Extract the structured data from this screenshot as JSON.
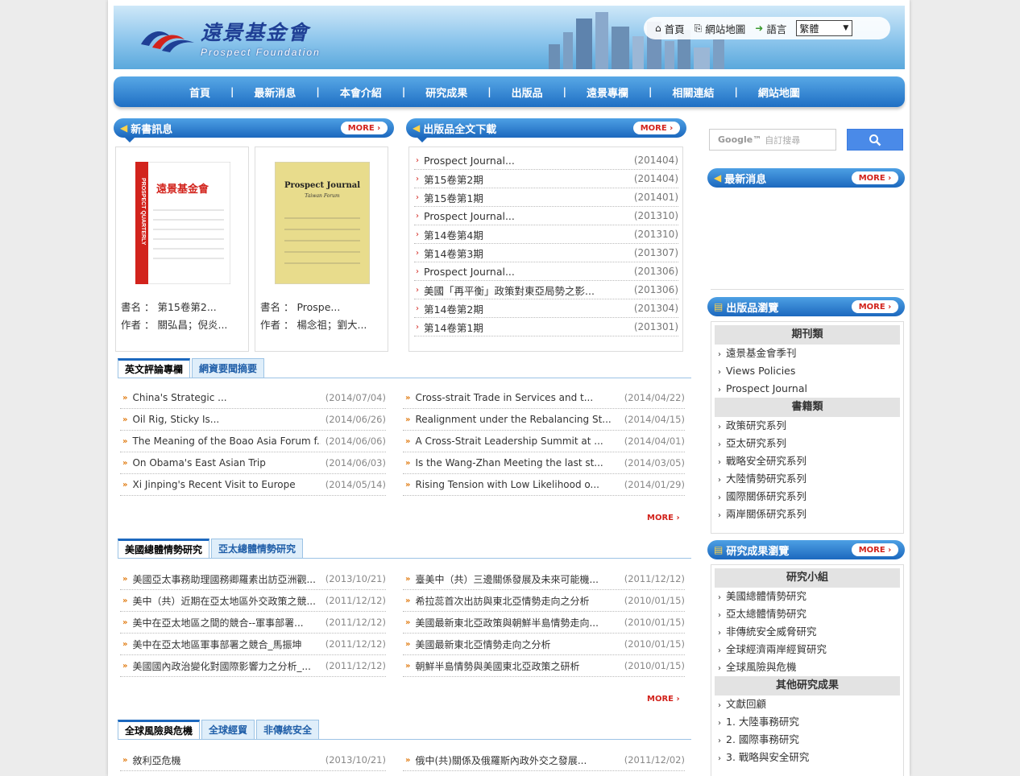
{
  "header": {
    "logo_name": "遠景基金會",
    "logo_sub": "Prospect Foundation",
    "links": [
      "首頁",
      "網站地圖",
      "語言"
    ],
    "language_selected": "繁體"
  },
  "nav": [
    "首頁",
    "最新消息",
    "本會介紹",
    "研究成果",
    "出版品",
    "遠景專欄",
    "相關連結",
    "網站地圖"
  ],
  "new_books": {
    "title": "新書訊息",
    "more": "MORE",
    "books": [
      {
        "title_label": "書名 ：",
        "title": "第15卷第2...",
        "author_label": "作者 ：",
        "author": "關弘昌；倪炎...",
        "cover_title": "遠景基金會",
        "cover_side": "PROSPECT QUARTERLY"
      },
      {
        "title_label": "書名 ：",
        "title": "Prospe...",
        "author_label": "作者 ：",
        "author": "楊念祖；劉大...",
        "cover_title": "Prospect Journal",
        "cover_sub": "Taiwan Forum"
      }
    ]
  },
  "downloads": {
    "title": "出版品全文下載",
    "more": "MORE",
    "items": [
      {
        "title": "Prospect Journal...",
        "date": "(201404)"
      },
      {
        "title": "第15卷第2期",
        "date": "(201404)"
      },
      {
        "title": "第15卷第1期",
        "date": "(201401)"
      },
      {
        "title": "Prospect Journal...",
        "date": "(201310)"
      },
      {
        "title": "第14卷第4期",
        "date": "(201310)"
      },
      {
        "title": "第14卷第3期",
        "date": "(201307)"
      },
      {
        "title": "Prospect Journal...",
        "date": "(201306)"
      },
      {
        "title": "美國「再平衡」政策對東亞局勢之影...",
        "date": "(201306)"
      },
      {
        "title": "第14卷第2期",
        "date": "(201304)"
      },
      {
        "title": "第14卷第1期",
        "date": "(201301)"
      }
    ]
  },
  "section1": {
    "tabs": [
      "英文評論專欄",
      "網資要聞摘要"
    ],
    "left": [
      {
        "title": "China's Strategic ...",
        "date": "(2014/07/04)"
      },
      {
        "title": "Oil Rig, Sticky Is...",
        "date": "(2014/06/26)"
      },
      {
        "title": "The Meaning of the Boao Asia Forum f...",
        "date": "(2014/06/06)"
      },
      {
        "title": "On Obama's East Asian Trip",
        "date": "(2014/06/03)"
      },
      {
        "title": "Xi Jinping's Recent Visit to Europe",
        "date": "(2014/05/14)"
      }
    ],
    "right": [
      {
        "title": "Cross-strait Trade in Services and t...",
        "date": "(2014/04/22)"
      },
      {
        "title": "Realignment under the Rebalancing St...",
        "date": "(2014/04/15)"
      },
      {
        "title": "A Cross-Strait Leadership Summit at ...",
        "date": "(2014/04/01)"
      },
      {
        "title": "Is the Wang-Zhan Meeting the last st...",
        "date": "(2014/03/05)"
      },
      {
        "title": "Rising Tension with Low Likelihood o...",
        "date": "(2014/01/29)"
      }
    ],
    "more": "MORE"
  },
  "section2": {
    "tabs": [
      "美國總體情勢研究",
      "亞太總體情勢研究"
    ],
    "left": [
      {
        "title": "美國亞太事務助理國務卿羅素出訪亞洲觀...",
        "date": "(2013/10/21)"
      },
      {
        "title": "美中（共）近期在亞太地區外交政策之競...",
        "date": "(2011/12/12)"
      },
      {
        "title": "美中在亞太地區之間的競合--軍事部署...",
        "date": "(2011/12/12)"
      },
      {
        "title": "美中在亞太地區軍事部署之競合_馬振坤",
        "date": "(2011/12/12)"
      },
      {
        "title": "美國國內政治變化對國際影響力之分析_...",
        "date": "(2011/12/12)"
      }
    ],
    "right": [
      {
        "title": "臺美中（共）三邊關係發展及未來可能機...",
        "date": "(2011/12/12)"
      },
      {
        "title": "希拉蕊首次出訪與東北亞情勢走向之分析",
        "date": "(2010/01/15)"
      },
      {
        "title": "美國最新東北亞政策與朝鮮半島情勢走向...",
        "date": "(2010/01/15)"
      },
      {
        "title": "美國最新東北亞情勢走向之分析",
        "date": "(2010/01/15)"
      },
      {
        "title": "朝鮮半島情勢與美國東北亞政策之研析",
        "date": "(2010/01/15)"
      }
    ],
    "more": "MORE"
  },
  "section3": {
    "tabs": [
      "全球風險與危機",
      "全球經貿",
      "非傳統安全"
    ],
    "left": [
      {
        "title": "敘利亞危機",
        "date": "(2013/10/21)"
      }
    ],
    "right": [
      {
        "title": "俄中(共)關係及俄羅斯內政外交之發展...",
        "date": "(2011/12/02)"
      }
    ]
  },
  "search": {
    "placeholder": "自訂搜尋",
    "brand": "Google™"
  },
  "latest_news": {
    "title": "最新消息",
    "more": "MORE"
  },
  "publications": {
    "title": "出版品瀏覽",
    "more": "MORE",
    "groups": [
      {
        "name": "期刊類",
        "items": [
          "遠景基金會季刊",
          "Views Policies",
          "Prospect Journal"
        ]
      },
      {
        "name": "書籍類",
        "items": [
          "政策研究系列",
          "亞太研究系列",
          "戰略安全研究系列",
          "大陸情勢研究系列",
          "國際關係研究系列",
          "兩岸關係研究系列"
        ]
      }
    ]
  },
  "research": {
    "title": "研究成果瀏覽",
    "more": "MORE",
    "groups": [
      {
        "name": "研究小組",
        "items": [
          "美國總體情勢研究",
          "亞太總體情勢研究",
          "非傳統安全威脅研究",
          "全球經濟兩岸經貿研究",
          "全球風險與危機"
        ]
      },
      {
        "name": "其他研究成果",
        "items": [
          "文獻回顧",
          "1. 大陸事務研究",
          "2. 國際事務研究",
          "3. 戰略與安全研究"
        ]
      }
    ]
  },
  "colors": {
    "nav_blue": "#1c68be",
    "accent_red": "#d2231c",
    "arrow_orange": "#e07a10"
  }
}
